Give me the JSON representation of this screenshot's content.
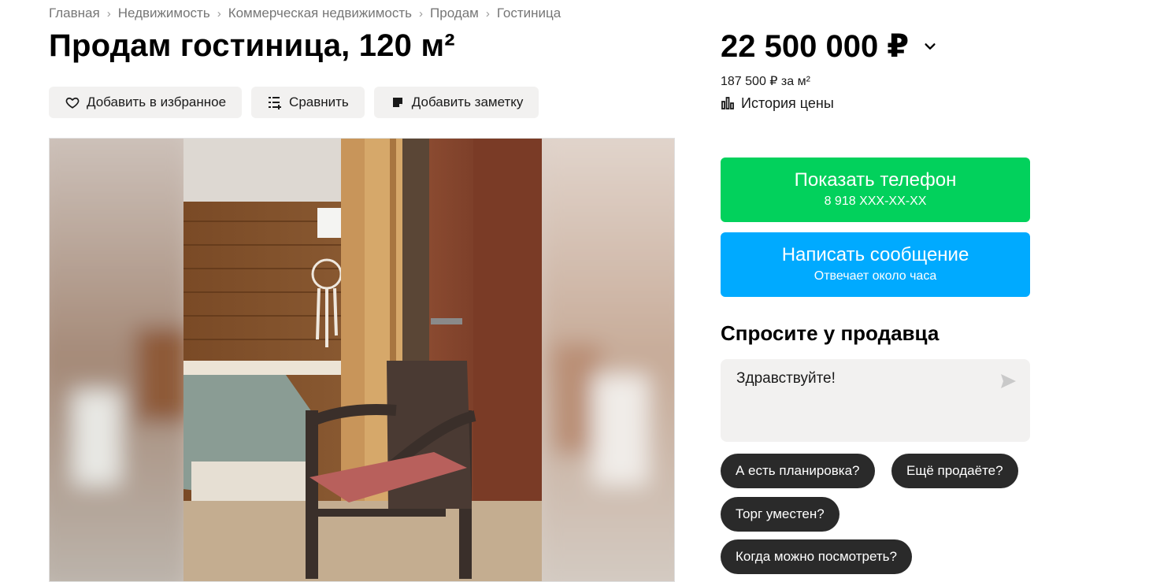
{
  "breadcrumb": [
    "Главная",
    "Недвижимость",
    "Коммерческая недвижимость",
    "Продам",
    "Гостиница"
  ],
  "title": "Продам гостиница, 120 м²",
  "actions": {
    "favorite": "Добавить в избранное",
    "compare": "Сравнить",
    "note": "Добавить заметку"
  },
  "price": {
    "value": "22 500 000 ₽",
    "per_m": "187 500 ₽ за м²",
    "history": "История цены"
  },
  "contact": {
    "phone_label": "Показать телефон",
    "phone_masked": "8 918 XXX-XX-XX",
    "message_label": "Написать сообщение",
    "message_sub": "Отвечает около часа"
  },
  "ask": {
    "title": "Спросите у продавца",
    "text": "Здравствуйте!",
    "chips": [
      "А есть планировка?",
      "Ещё продаёте?",
      "Торг уместен?",
      "Когда можно посмотреть?"
    ]
  },
  "colors": {
    "phone_button": "#02d15c",
    "message_button": "#00aaff",
    "chip": "#2a2a2a",
    "action_bg": "#f2f1f0"
  },
  "icons": [
    "heart-icon",
    "compare-icon",
    "note-icon",
    "chevron-down-icon",
    "chart-icon",
    "send-icon"
  ]
}
